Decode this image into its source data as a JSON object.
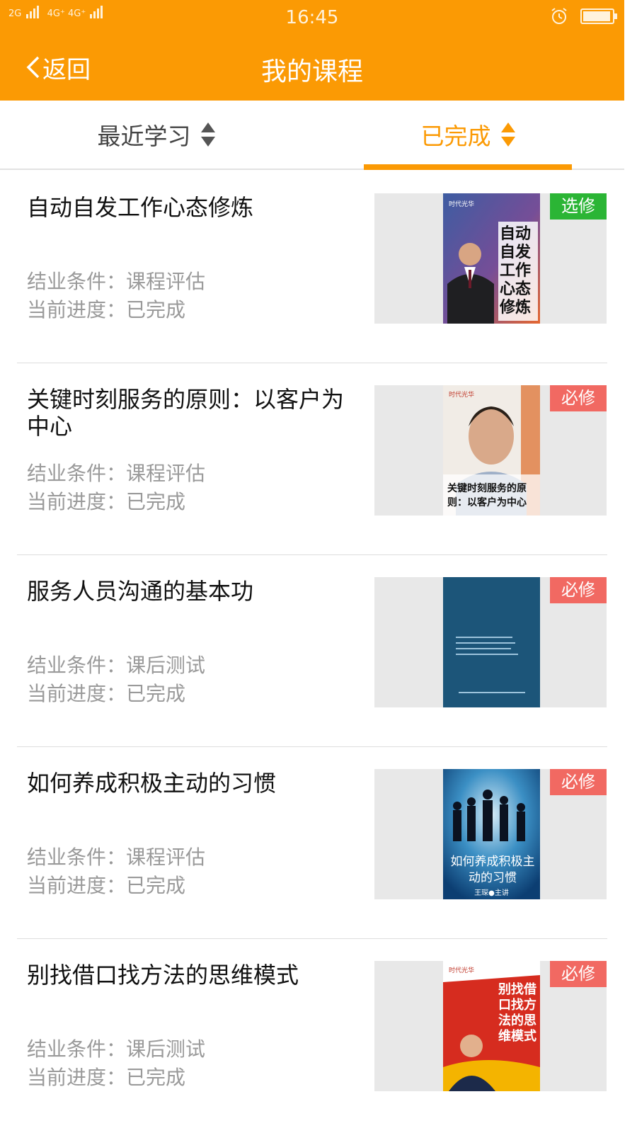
{
  "status_bar": {
    "signal_left": "2G",
    "signal_mid": "4G⁺ 4G⁺",
    "signal_sub": "2G",
    "time": "16:45"
  },
  "header": {
    "back_label": "返回",
    "title": "我的课程",
    "accent_color": "#fb9a04"
  },
  "tabs": [
    {
      "label": "最近学习",
      "active": false
    },
    {
      "label": "已完成",
      "active": true
    }
  ],
  "courses": [
    {
      "title": "自动自发工作心态修炼",
      "condition": "结业条件：课程评估",
      "progress": "当前进度：已完成",
      "badge": "选修",
      "badge_color": "#2bb535",
      "cover": {
        "publisher": "时代光华",
        "text": "自动自发工作心态修炼"
      }
    },
    {
      "title": "关键时刻服务的原则：以客户为中心",
      "condition": "结业条件：课程评估",
      "progress": "当前进度：已完成",
      "badge": "必修",
      "badge_color": "#f16962",
      "cover": {
        "publisher": "时代光华",
        "text": "关键时刻服务的原则：以客户为中心"
      }
    },
    {
      "title": "服务人员沟通的基本功",
      "condition": "结业条件：课后测试",
      "progress": "当前进度：已完成",
      "badge": "必修",
      "badge_color": "#f16962",
      "cover": {
        "publisher": "",
        "text": ""
      }
    },
    {
      "title": "如何养成积极主动的习惯",
      "condition": "结业条件：课程评估",
      "progress": "当前进度：已完成",
      "badge": "必修",
      "badge_color": "#f16962",
      "cover": {
        "publisher": "",
        "text": "如何养成积极主动的习惯",
        "author": "王琛●主讲"
      }
    },
    {
      "title": "别找借口找方法的思维模式",
      "condition": "结业条件：课后测试",
      "progress": "当前进度：已完成",
      "badge": "必修",
      "badge_color": "#f16962",
      "cover": {
        "publisher": "时代光华",
        "text": "别找借口找方法的思维模式"
      }
    }
  ]
}
